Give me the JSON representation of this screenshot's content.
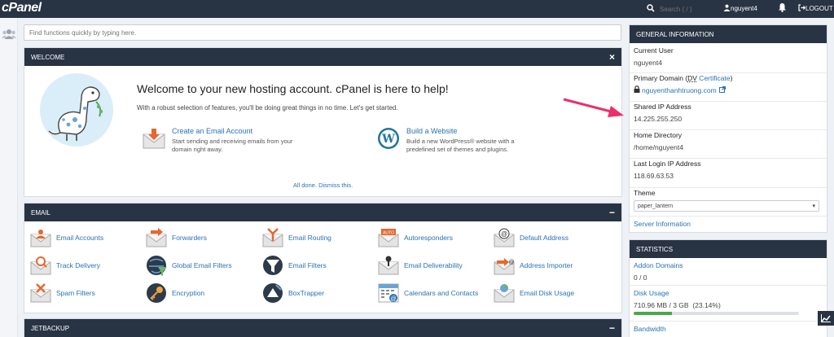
{
  "topbar": {
    "logo": "cPanel",
    "search_placeholder": "Search ( / )",
    "username": "nguyent4",
    "logout": "LOGOUT"
  },
  "find": {
    "placeholder": "Find functions quickly by typing here."
  },
  "welcome": {
    "header": "WELCOME",
    "close": "×",
    "title": "Welcome to your new hosting account. cPanel is here to help!",
    "subtitle": "With a robust selection of features, you'll be doing great things in no time. Let's get started.",
    "cards": [
      {
        "link": "Create an Email Account",
        "desc": "Start sending and receiving emails from your domain right away.",
        "icon": "envelope-download-icon"
      },
      {
        "link": "Build a Website",
        "desc": "Build a new WordPress® website with a predefined set of themes and plugins.",
        "icon": "wordpress-icon"
      }
    ],
    "done": "All done. Dismiss this."
  },
  "email": {
    "header": "EMAIL",
    "collapse": "−",
    "items": [
      {
        "label": "Email Accounts",
        "icon": "email-accounts-icon"
      },
      {
        "label": "Forwarders",
        "icon": "forwarders-icon"
      },
      {
        "label": "Email Routing",
        "icon": "email-routing-icon"
      },
      {
        "label": "Autoresponders",
        "icon": "autoresponders-icon"
      },
      {
        "label": "Default Address",
        "icon": "default-address-icon"
      },
      {
        "label": "Track Delivery",
        "icon": "track-delivery-icon"
      },
      {
        "label": "Global Email Filters",
        "icon": "global-email-filters-icon"
      },
      {
        "label": "Email Filters",
        "icon": "email-filters-icon"
      },
      {
        "label": "Email Deliverability",
        "icon": "email-deliverability-icon"
      },
      {
        "label": "Address Importer",
        "icon": "address-importer-icon"
      },
      {
        "label": "Spam Filters",
        "icon": "spam-filters-icon"
      },
      {
        "label": "Encryption",
        "icon": "encryption-icon"
      },
      {
        "label": "BoxTrapper",
        "icon": "boxtrapper-icon"
      },
      {
        "label": "Calendars and Contacts",
        "icon": "calendars-contacts-icon"
      },
      {
        "label": "Email Disk Usage",
        "icon": "email-disk-usage-icon"
      }
    ]
  },
  "jetbackup": {
    "header": "JETBACKUP",
    "collapse": "−"
  },
  "general": {
    "header": "GENERAL INFORMATION",
    "current_user_label": "Current User",
    "current_user": "nguyent4",
    "primary_domain_label": "Primary Domain (",
    "dv": "DV",
    "certificate": " Certificate",
    "primary_domain_close": ")",
    "domain": "nguyenthanhtruong.com",
    "shared_ip_label": "Shared IP Address",
    "shared_ip": "14.225.255.250",
    "home_label": "Home Directory",
    "home": "/home/nguyent4",
    "last_login_label": "Last Login IP Address",
    "last_login": "118.69.63.53",
    "theme_label": "Theme",
    "theme": "paper_lantern",
    "server_info": "Server Information"
  },
  "stats": {
    "header": "STATISTICS",
    "addon_label": "Addon Domains",
    "addon_value": "0 / 0",
    "disk_label": "Disk Usage",
    "disk_value": "710.96 MB / 3 GB",
    "disk_pct": "(23.14%)",
    "disk_fraction": 0.2314,
    "bandwidth_label": "Bandwidth"
  }
}
